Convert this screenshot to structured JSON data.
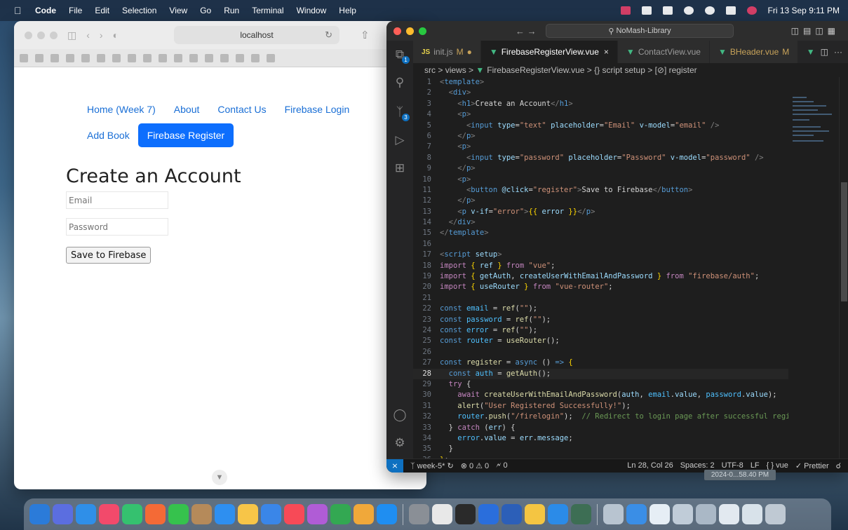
{
  "menubar": {
    "app_name": "Code",
    "items": [
      "File",
      "Edit",
      "Selection",
      "View",
      "Go",
      "Run",
      "Terminal",
      "Window",
      "Help"
    ],
    "clock": "Fri 13 Sep  9:11 PM"
  },
  "safari": {
    "url": "localhost",
    "nav": {
      "home": "Home (Week 7)",
      "about": "About",
      "contact": "Contact Us",
      "firebase_login": "Firebase Login",
      "add_book": "Add Book",
      "firebase_register": "Firebase Register"
    },
    "heading": "Create an Account",
    "email_placeholder": "Email",
    "password_placeholder": "Password",
    "save_button": "Save to Firebase"
  },
  "vscode": {
    "search": "NoMash-Library",
    "tabs": [
      {
        "label": "init.js",
        "icon": "js-icon",
        "suffix": "M"
      },
      {
        "label": "FirebaseRegisterView.vue",
        "icon": "vue-icon",
        "suffix": "×"
      },
      {
        "label": "ContactView.vue",
        "icon": "vue-icon",
        "suffix": ""
      },
      {
        "label": "BHeader.vue",
        "icon": "vue-icon",
        "suffix": "M"
      }
    ],
    "breadcrumb": {
      "src": "src",
      "views": "views",
      "file": "FirebaseRegisterView.vue",
      "scope": "{} script setup",
      "symbol": "[⊘] register"
    },
    "status": {
      "branch": "week-5*",
      "problems": "⊗ 0 ⚠ 0",
      "ports": "🗲 0",
      "position": "Ln 28, Col 26",
      "spaces": "Spaces: 2",
      "encoding": "UTF-8",
      "eol": "LF",
      "language": "vue",
      "formatter": "✓ Prettier"
    },
    "tooltip": "2024-0...58.40 PM"
  },
  "code_lines": [
    {
      "n": "1",
      "html": "<span class='tg'>&lt;</span><span class='tag'>template</span><span class='tg'>&gt;</span>"
    },
    {
      "n": "2",
      "html": "  <span class='tg'>&lt;</span><span class='tag'>div</span><span class='tg'>&gt;</span>"
    },
    {
      "n": "3",
      "html": "    <span class='tg'>&lt;</span><span class='tag'>h1</span><span class='tg'>&gt;</span>Create an Account<span class='tg'>&lt;/</span><span class='tag'>h1</span><span class='tg'>&gt;</span>"
    },
    {
      "n": "4",
      "html": "    <span class='tg'>&lt;</span><span class='tag'>p</span><span class='tg'>&gt;</span>"
    },
    {
      "n": "5",
      "html": "      <span class='tg'>&lt;</span><span class='tag'>input</span> <span class='att'>type</span>=<span class='str'>\"text\"</span> <span class='att'>placeholder</span>=<span class='str'>\"Email\"</span> <span class='att'>v-model</span>=<span class='str'>\"email\"</span> <span class='tg'>/&gt;</span>"
    },
    {
      "n": "6",
      "html": "    <span class='tg'>&lt;/</span><span class='tag'>p</span><span class='tg'>&gt;</span>"
    },
    {
      "n": "7",
      "html": "    <span class='tg'>&lt;</span><span class='tag'>p</span><span class='tg'>&gt;</span>"
    },
    {
      "n": "8",
      "html": "      <span class='tg'>&lt;</span><span class='tag'>input</span> <span class='att'>type</span>=<span class='str'>\"password\"</span> <span class='att'>placeholder</span>=<span class='str'>\"Password\"</span> <span class='att'>v-model</span>=<span class='str'>\"password\"</span> <span class='tg'>/&gt;</span>"
    },
    {
      "n": "9",
      "html": "    <span class='tg'>&lt;/</span><span class='tag'>p</span><span class='tg'>&gt;</span>"
    },
    {
      "n": "10",
      "html": "    <span class='tg'>&lt;</span><span class='tag'>p</span><span class='tg'>&gt;</span>"
    },
    {
      "n": "11",
      "html": "      <span class='tg'>&lt;</span><span class='tag'>button</span> <span class='att'>@click</span>=<span class='str'>\"register\"</span><span class='tg'>&gt;</span>Save to Firebase<span class='tg'>&lt;/</span><span class='tag'>button</span><span class='tg'>&gt;</span>"
    },
    {
      "n": "12",
      "html": "    <span class='tg'>&lt;/</span><span class='tag'>p</span><span class='tg'>&gt;</span>"
    },
    {
      "n": "13",
      "html": "    <span class='tg'>&lt;</span><span class='tag'>p</span> <span class='att'>v-if</span>=<span class='str'>\"error\"</span><span class='tg'>&gt;</span><span class='br'>{{</span> <span class='id'>error</span> <span class='br'>}}</span><span class='tg'>&lt;/</span><span class='tag'>p</span><span class='tg'>&gt;</span>"
    },
    {
      "n": "14",
      "html": "  <span class='tg'>&lt;/</span><span class='tag'>div</span><span class='tg'>&gt;</span>"
    },
    {
      "n": "15",
      "html": "<span class='tg'>&lt;/</span><span class='tag'>template</span><span class='tg'>&gt;</span>"
    },
    {
      "n": "16",
      "html": ""
    },
    {
      "n": "17",
      "html": "<span class='tg'>&lt;</span><span class='tag'>script</span> <span class='att'>setup</span><span class='tg'>&gt;</span>"
    },
    {
      "n": "18",
      "html": "<span class='kw'>import</span> <span class='br'>{</span> <span class='id'>ref</span> <span class='br'>}</span> <span class='kw'>from</span> <span class='str'>\"vue\"</span>;"
    },
    {
      "n": "19",
      "html": "<span class='kw'>import</span> <span class='br'>{</span> <span class='id'>getAuth</span>, <span class='id'>createUserWithEmailAndPassword</span> <span class='br'>}</span> <span class='kw'>from</span> <span class='str'>\"firebase/auth\"</span>;"
    },
    {
      "n": "20",
      "html": "<span class='kw'>import</span> <span class='br'>{</span> <span class='id'>useRouter</span> <span class='br'>}</span> <span class='kw'>from</span> <span class='str'>\"vue-router\"</span>;"
    },
    {
      "n": "21",
      "html": ""
    },
    {
      "n": "22",
      "html": "<span class='kb'>const</span> <span class='vr'>email</span> = <span class='fn'>ref</span>(<span class='str'>\"\"</span>);"
    },
    {
      "n": "23",
      "html": "<span class='kb'>const</span> <span class='vr'>password</span> = <span class='fn'>ref</span>(<span class='str'>\"\"</span>);"
    },
    {
      "n": "24",
      "html": "<span class='kb'>const</span> <span class='vr'>error</span> = <span class='fn'>ref</span>(<span class='str'>\"\"</span>);"
    },
    {
      "n": "25",
      "html": "<span class='kb'>const</span> <span class='vr'>router</span> = <span class='fn'>useRouter</span>();"
    },
    {
      "n": "26",
      "html": ""
    },
    {
      "n": "27",
      "html": "<span class='kb'>const</span> <span class='fn'>register</span> = <span class='kb'>async</span> () <span class='kb'>=&gt;</span> <span class='br'>{</span>"
    },
    {
      "n": "28",
      "html": "  <span class='kb'>const</span> <span class='vr'>auth</span> = <span class='fn'>getAuth</span>();",
      "cur": true
    },
    {
      "n": "29",
      "html": "  <span class='kw'>try</span> {"
    },
    {
      "n": "30",
      "html": "    <span class='kw'>await</span> <span class='fn'>createUserWithEmailAndPassword</span>(<span class='id'>auth</span>, <span class='vr'>email</span>.<span class='id'>value</span>, <span class='vr'>password</span>.<span class='id'>value</span>);"
    },
    {
      "n": "31",
      "html": "    <span class='fn'>alert</span>(<span class='str'>\"User Registered Successfully!\"</span>);"
    },
    {
      "n": "32",
      "html": "    <span class='vr'>router</span>.<span class='fn'>push</span>(<span class='str'>\"/firelogin\"</span>);  <span class='cm'>// Redirect to login page after successful regis</span>"
    },
    {
      "n": "33",
      "html": "  } <span class='kw'>catch</span> (<span class='id'>err</span>) {"
    },
    {
      "n": "34",
      "html": "    <span class='vr'>error</span>.<span class='id'>value</span> = <span class='id'>err</span>.<span class='id'>message</span>;"
    },
    {
      "n": "35",
      "html": "  }"
    },
    {
      "n": "36",
      "html": "<span class='br'>}</span>;"
    }
  ],
  "dock_colors": [
    "#2b7bd9",
    "#5b6ee0",
    "#2f8fe8",
    "#f24a6b",
    "#35c16f",
    "#f46a36",
    "#36c24d",
    "#b58a5a",
    "#2e8ff0",
    "#f7c548",
    "#3a86e8",
    "#f74a57",
    "#b05cd6",
    "#33a852",
    "#f0a83a",
    "#1f8ef1",
    "#8a8f96",
    "#e8e8e8",
    "#2a2a2a",
    "#2a6edc",
    "#2c5fb8",
    "#f4c542",
    "#2b8be8",
    "#3d6e54",
    "#b8c4d0",
    "#3a8ee6",
    "#e6eef5",
    "#c0ccd8",
    "#aab8c6",
    "#e2e9f0",
    "#d8e2ea",
    "#bfc9d3"
  ]
}
